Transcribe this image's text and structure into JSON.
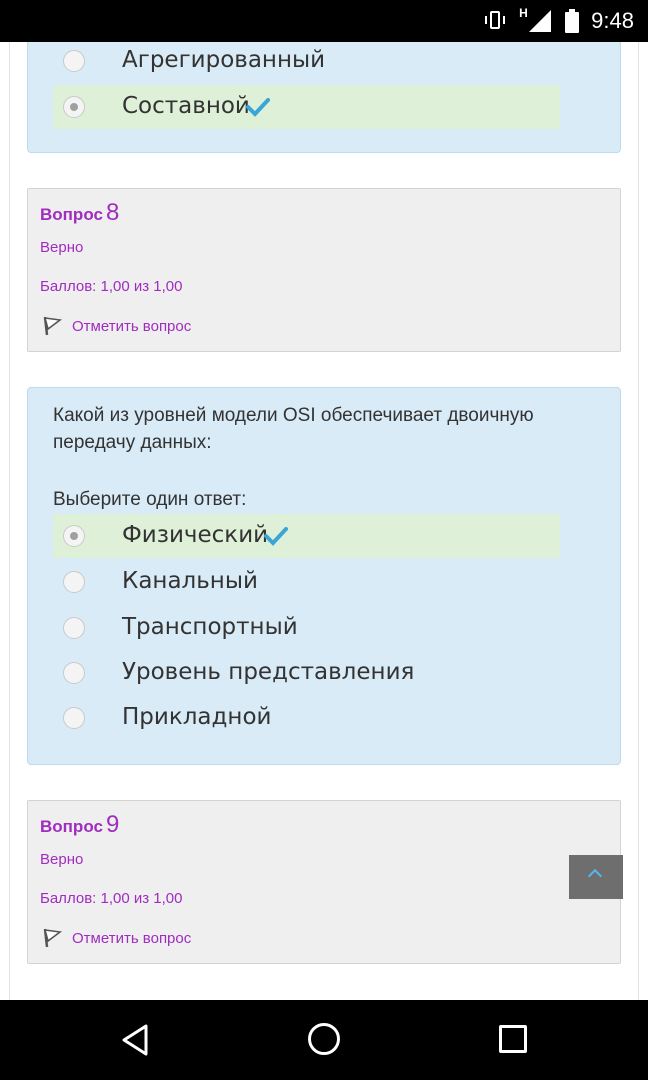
{
  "status_bar": {
    "time": "9:48",
    "network_type": "H",
    "icons": [
      "vibrate-icon",
      "signal-icon",
      "battery-icon"
    ]
  },
  "question7": {
    "options": [
      {
        "label": "Агрегированный",
        "selected": false,
        "correct": false
      },
      {
        "label": "Составной",
        "selected": true,
        "correct": true
      }
    ]
  },
  "question8_info": {
    "label": "Вопрос",
    "number": "8",
    "status": "Верно",
    "score": "Баллов: 1,00 из 1,00",
    "flag_label": "Отметить вопрос"
  },
  "question8": {
    "text": "Какой из уровней модели OSI обеспечивает двоичную передачу данных:",
    "prompt": "Выберите один ответ:",
    "options": [
      {
        "label": "Физический",
        "selected": true,
        "correct": true
      },
      {
        "label": "Канальный",
        "selected": false,
        "correct": false
      },
      {
        "label": "Транспортный",
        "selected": false,
        "correct": false
      },
      {
        "label": "Уровень представления",
        "selected": false,
        "correct": false
      },
      {
        "label": "Прикладной",
        "selected": false,
        "correct": false
      }
    ]
  },
  "question9_info": {
    "label": "Вопрос",
    "number": "9",
    "status": "Верно",
    "score": "Баллов: 1,00 из 1,00",
    "flag_label": "Отметить вопрос"
  },
  "colors": {
    "accent": "#a02cc0",
    "question_bg": "#d9ebf6",
    "info_bg": "#efefef",
    "correct_bg": "#dff0d8",
    "checkmark": "#3aa6d6"
  }
}
